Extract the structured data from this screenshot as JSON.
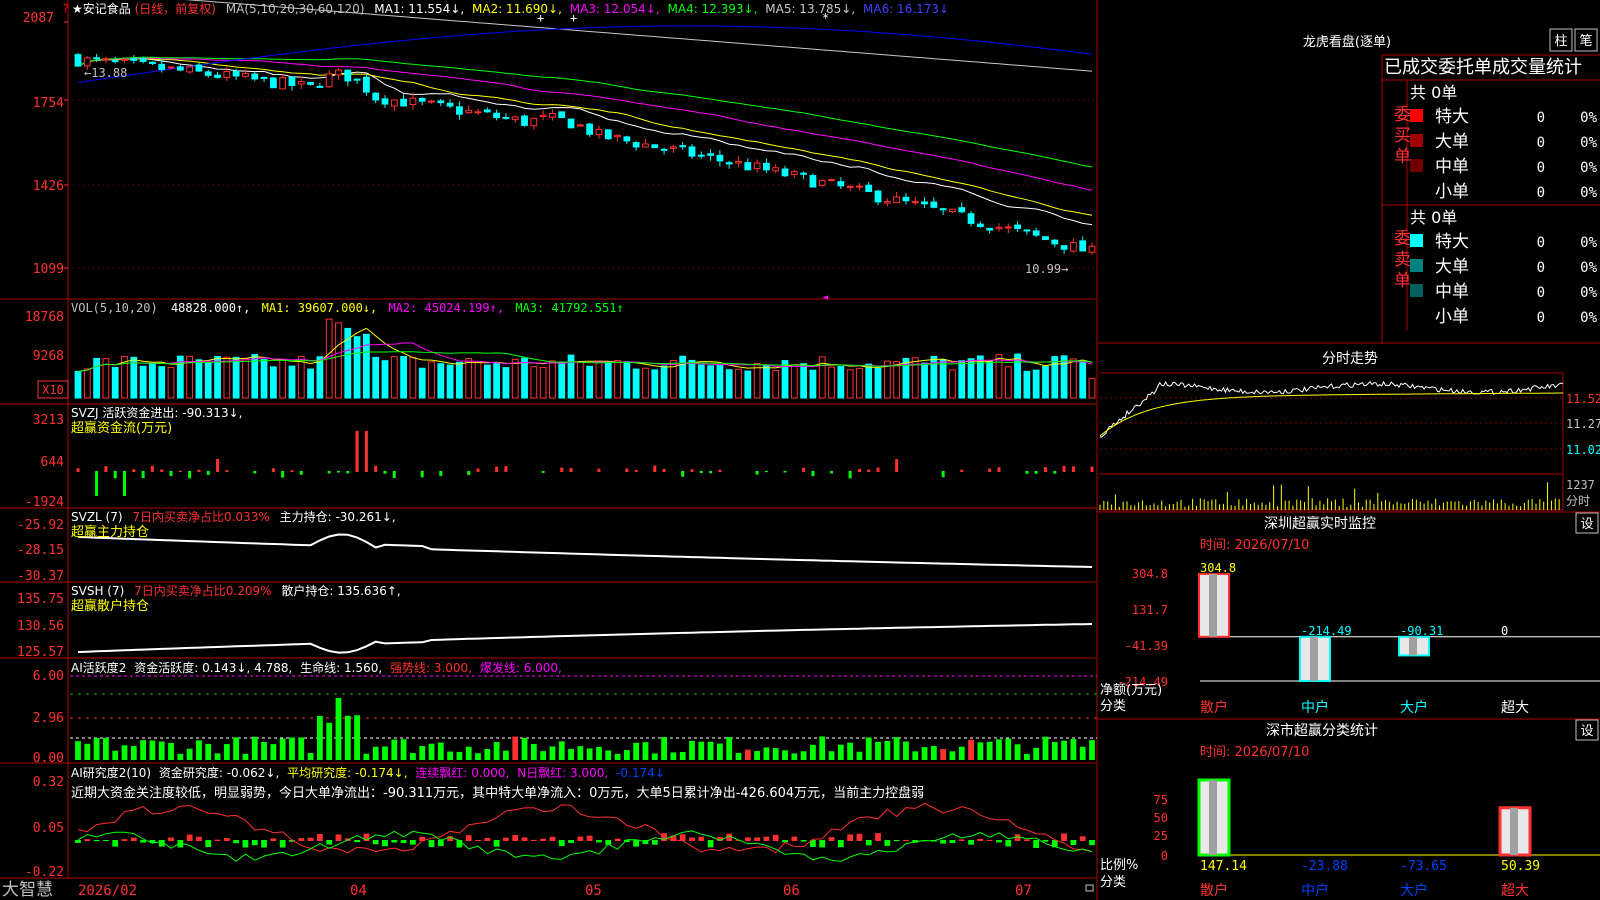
{
  "colors": {
    "up": "#ff3030",
    "down": "#00ffff",
    "border": "#b00000",
    "grid": "#800000",
    "ma1": "#ffffff",
    "ma2": "#ffff00",
    "ma3": "#ff00ff",
    "ma4": "#00ff00",
    "ma5": "#c8c8c8",
    "ma6": "#0000ff",
    "text": "#c0c0c0",
    "label_red": "#ff0000"
  },
  "header": {
    "stock_name": "★安记食品",
    "period": "(日线，前复权)",
    "ma_params": "MA(5,10,20,30,60,120)",
    "ma1": "MA1: 11.554↓,",
    "ma2": "MA2: 11.690↓,",
    "ma3": "MA3: 12.054↓,",
    "ma4": "MA4: 12.393↓,",
    "ma5": "MA5: 13.785↓,",
    "ma6": "MA6: 16.173↓"
  },
  "price_axis": [
    "2087",
    "1754",
    "1426",
    "1099"
  ],
  "price_annotations": {
    "high": "←13.88",
    "low": "10.99→"
  },
  "vol_panel": {
    "header": "VOL(5,10,20)",
    "value": "48828.000↑,",
    "ma1": "MA1: 39607.000↓,",
    "ma2": "MA2: 45024.199↑,",
    "ma3": "MA3: 41792.551↑",
    "axis": [
      "18768",
      "9268"
    ],
    "unit": "X10"
  },
  "svzj_panel": {
    "header": "SVZJ  活跃资金进出: -90.313↓,",
    "subtitle": "超赢资金流(万元)",
    "axis": [
      "3213",
      "644",
      "-1924"
    ]
  },
  "svzl_panel": {
    "name": "SVZL (7)",
    "part1": "7日内买卖净占比0.033%",
    "part2": "主力持仓: -30.261↓,",
    "subtitle": "超赢主力持仓",
    "axis": [
      "-25.92",
      "-28.15",
      "-30.37"
    ]
  },
  "svsh_panel": {
    "name": "SVSH (7)",
    "part1": "7日内买卖净占比0.209%",
    "part2": "散户持仓: 135.636↑,",
    "subtitle": "超赢散户持仓",
    "axis": [
      "135.75",
      "130.56",
      "125.57"
    ]
  },
  "ai_active_panel": {
    "name": "AI活跃度2",
    "part1": "资金活跃度: 0.143↓, 4.788,",
    "part2": "生命线: 1.560,",
    "part3": "强势线: 3.000,",
    "part4": "爆发线: 6.000,",
    "axis": [
      "6.00",
      "2.96",
      "0.00"
    ]
  },
  "ai_research_panel": {
    "name": "AI研究度2(10)",
    "part1": "资金研究度: -0.062↓,",
    "part2": "平均研究度: -0.174↓,",
    "part3": "连续飘红: 0.000,",
    "part4": "N日飘红: 3.000,",
    "part5": "-0.174↓",
    "comment": "近期大资金关注度较低，明显弱势，今日大单净流出：-90.311万元，其中特大单净流入：0万元，大单5日累计净出-426.604万元，当前主力控盘弱",
    "axis": [
      "0.32",
      "0.05",
      "-0.22"
    ]
  },
  "date_axis": [
    "2026/02",
    "04",
    "05",
    "06",
    "07"
  ],
  "bottom": {
    "app_name": "大智慧"
  },
  "lhb": {
    "title": "龙虎看盘(逐单)",
    "btn1": "柱",
    "btn2": "笔",
    "subheader": "已成交委托单成交量统计",
    "buy_group": "委买单",
    "sell_group": "委卖单",
    "buy_total": "共 0单",
    "sell_total": "共 0单",
    "buy_rows": [
      {
        "label": "特大",
        "count": "0",
        "pct": "0%",
        "color": "#ff0000"
      },
      {
        "label": "大单",
        "count": "0",
        "pct": "0%",
        "color": "#a00000"
      },
      {
        "label": "中单",
        "count": "0",
        "pct": "0%",
        "color": "#700000"
      },
      {
        "label": "小单",
        "count": "0",
        "pct": "0%",
        "color": ""
      }
    ],
    "sell_rows": [
      {
        "label": "特大",
        "count": "0",
        "pct": "0%",
        "color": "#00ffff"
      },
      {
        "label": "大单",
        "count": "0",
        "pct": "0%",
        "color": "#008080"
      },
      {
        "label": "中单",
        "count": "0",
        "pct": "0%",
        "color": "#006060"
      },
      {
        "label": "小单",
        "count": "0",
        "pct": "0%",
        "color": ""
      }
    ]
  },
  "intraday": {
    "title": "分时走势",
    "axis": [
      "11.52",
      "11.27",
      "11.02"
    ],
    "vol_value": "1237",
    "vol_label": "分时"
  },
  "monitor": {
    "title": "深圳超赢实时监控",
    "settings": "设",
    "time_label": "时间: 2026/07/10",
    "axis": [
      "304.8",
      "131.7",
      "-41.39",
      "-214.49"
    ],
    "y_unit": "净额(万元)",
    "x_label": "分类"
  },
  "classstat": {
    "title": "深市超赢分类统计",
    "settings": "设",
    "time_label": "时间: 2026/07/10",
    "axis": [
      "75",
      "50",
      "25",
      "0"
    ],
    "y_unit": "比例%",
    "x_label": "分类"
  },
  "chart_data": [
    {
      "type": "candlestick",
      "title": "安记食品 日线 前复权",
      "ylabel": "",
      "ma_names": [
        "MA1",
        "MA2",
        "MA3",
        "MA4",
        "MA5",
        "MA6"
      ],
      "last_values": {
        "MA1": 11.554,
        "MA2": 11.69,
        "MA3": 12.054,
        "MA4": 12.393,
        "MA5": 13.785,
        "MA6": 16.173
      },
      "high_label": 13.88,
      "low_label": 10.99,
      "range": [
        10.85,
        14.5
      ],
      "x_ticks": [
        "2026/02",
        "04",
        "05",
        "06",
        "07"
      ]
    },
    {
      "type": "bar",
      "title": "VOL(5,10,20)",
      "last_value": 48828.0,
      "ma_values": {
        "MA1": 39607.0,
        "MA2": 45024.199,
        "MA3": 41792.551
      },
      "ylim": [
        0,
        20000
      ]
    },
    {
      "type": "bar",
      "title": "超赢资金流(万元)",
      "last_value": -90.313,
      "ylim": [
        -1924,
        3213
      ]
    },
    {
      "type": "line",
      "title": "超赢主力持仓",
      "last_value": -30.261,
      "ylim": [
        -30.37,
        -25.92
      ]
    },
    {
      "type": "line",
      "title": "超赢散户持仓",
      "last_value": 135.636,
      "ylim": [
        125.57,
        135.75
      ]
    },
    {
      "type": "bar",
      "title": "AI活跃度2",
      "last_value": 0.143,
      "lines": {
        "生命线": 1.56,
        "强势线": 3.0,
        "爆发线": 6.0
      },
      "ylim": [
        0,
        6.0
      ]
    },
    {
      "type": "bar",
      "title": "AI研究度2(10)",
      "last_value": -0.062,
      "average": -0.174,
      "ylim": [
        -0.22,
        0.32
      ]
    },
    {
      "type": "bar",
      "title": "深圳超赢实时监控",
      "categories": [
        "散户",
        "中户",
        "大户",
        "超大"
      ],
      "values": [
        304.8,
        -214.49,
        -90.31,
        0
      ],
      "value_labels": [
        "304.8",
        "-214.49",
        "-90.31",
        "0"
      ],
      "ylim": [
        -214.49,
        304.8
      ]
    },
    {
      "type": "bar",
      "title": "深市超赢分类统计",
      "categories": [
        "散户",
        "中户",
        "大户",
        "超大"
      ],
      "values": [
        147.14,
        -23.88,
        -73.65,
        50.39
      ],
      "value_labels": [
        "147.14",
        "-23.88",
        "-73.65",
        "50.39"
      ],
      "ylim": [
        0,
        75
      ]
    }
  ]
}
